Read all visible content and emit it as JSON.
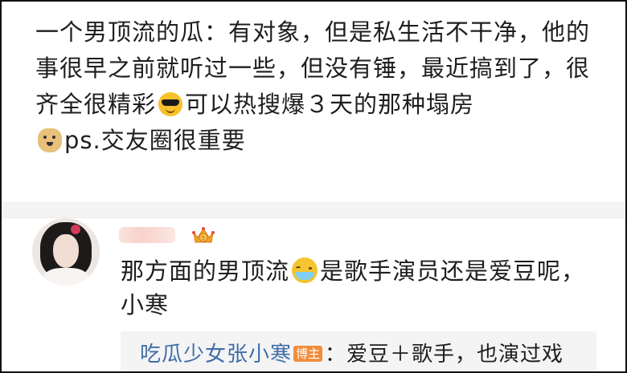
{
  "post": {
    "text_part1": "一个男顶流的瓜：有对象，但是私生活不干净，他的事很早之前就听过一些，但没有锤，最近搞到了，很齐全很精彩",
    "emoji1": "cool-sunglasses-emoji",
    "text_part2": "可以热搜爆３天的那种塌房",
    "emoji2": "doge-emoji",
    "text_part3": "ps.交友圈很重要"
  },
  "comment": {
    "avatar": "user-avatar",
    "username_redacted": true,
    "badge_icon": "crown-icon",
    "text_part1": "那方面的男顶流",
    "emoji": "tears-of-joy-emoji",
    "text_part2": "是歌手演员还是爱豆呢，小寒"
  },
  "reply": {
    "author": "吃瓜少女张小寒",
    "badge": "博主",
    "text": "：爱豆＋歌手，也演过戏"
  },
  "colors": {
    "link": "#3f6ea8",
    "badge": "#f28c3a",
    "reply_bg": "#f4f4f4"
  }
}
